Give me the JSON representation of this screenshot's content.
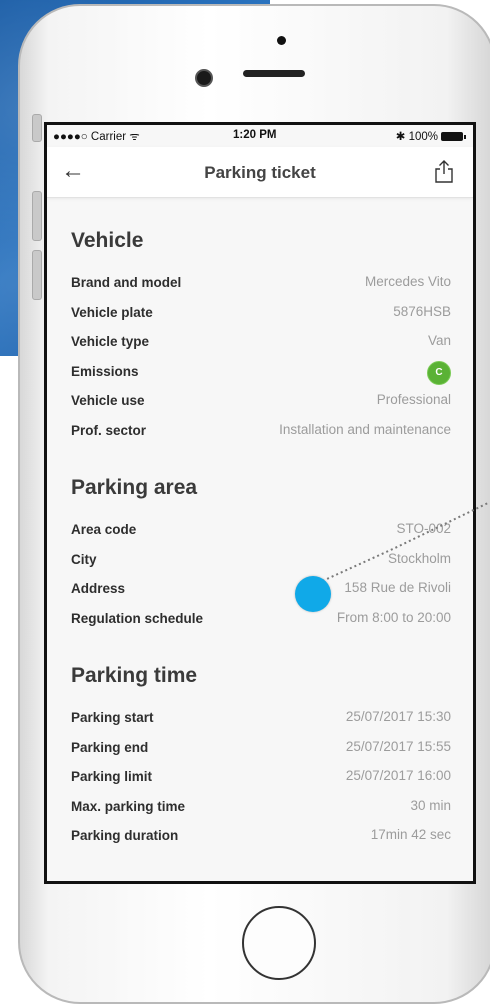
{
  "status_bar": {
    "carrier": "●●●●○ Carrier ᯤ",
    "time": "1:20 PM",
    "battery": "✱ 100%"
  },
  "nav": {
    "back_icon": "←",
    "title": "Parking ticket",
    "share_icon": "share-icon"
  },
  "vehicle": {
    "title": "Vehicle",
    "rows": [
      {
        "label": "Brand and model",
        "value": "Mercedes Vito"
      },
      {
        "label": "Vehicle plate",
        "value": "5876HSB"
      },
      {
        "label": "Vehicle type",
        "value": "Van"
      },
      {
        "label": "Emissions",
        "value": "C"
      },
      {
        "label": "Vehicle use",
        "value": "Professional"
      },
      {
        "label": "Prof. sector",
        "value": "Installation and maintenance"
      }
    ]
  },
  "parking_area": {
    "title": "Parking area",
    "rows": [
      {
        "label": "Area code",
        "value": "STO-002"
      },
      {
        "label": "City",
        "value": "Stockholm"
      },
      {
        "label": "Address",
        "value": "158 Rue de Rivoli"
      },
      {
        "label": "Regulation schedule",
        "value": "From 8:00 to 20:00"
      }
    ]
  },
  "parking_time": {
    "title": "Parking time",
    "rows": [
      {
        "label": "Parking start",
        "value": "25/07/2017 15:30"
      },
      {
        "label": "Parking end",
        "value": "25/07/2017 15:55"
      },
      {
        "label": "Parking limit",
        "value": "25/07/2017 16:00"
      },
      {
        "label": "Max. parking time",
        "value": "30 min"
      },
      {
        "label": "Parking duration",
        "value": "17min 42 sec"
      }
    ]
  },
  "colors": {
    "emission_badge": "#5ab235",
    "tap_indicator": "#10a9e8",
    "backdrop": "#1d5fa8"
  }
}
